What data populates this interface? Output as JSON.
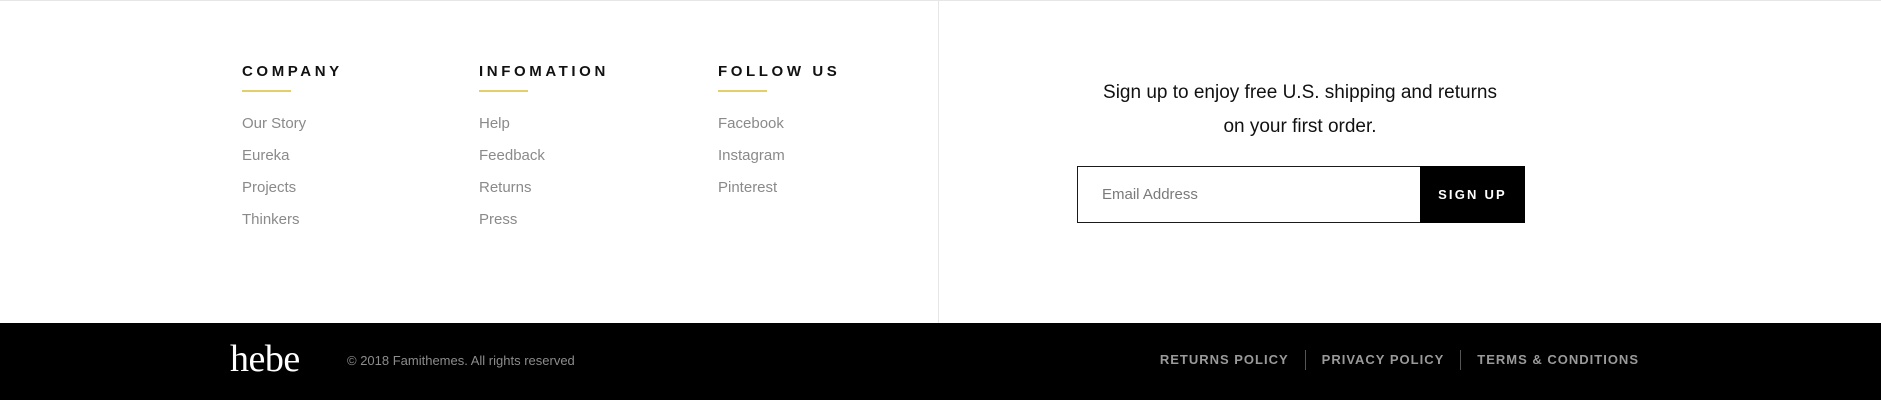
{
  "columns": {
    "company": {
      "heading": "COMPANY",
      "links": [
        "Our Story",
        "Eureka",
        "Projects",
        "Thinkers"
      ]
    },
    "information": {
      "heading": "INFOMATION",
      "links": [
        "Help",
        "Feedback",
        "Returns",
        "Press"
      ]
    },
    "follow": {
      "heading": "FOLLOW US",
      "links": [
        "Facebook",
        "Instagram",
        "Pinterest"
      ]
    }
  },
  "signup": {
    "line1": "Sign up to enjoy free U.S. shipping and returns",
    "line2": "on your first order.",
    "email_placeholder": "Email Address",
    "button_label": "SIGN UP"
  },
  "bottom": {
    "logo": "hebe",
    "copyright": "© 2018 Famithemes. All rights reserved",
    "policies": [
      "RETURNS POLICY",
      "PRIVACY POLICY",
      "TERMS & CONDITIONS"
    ]
  },
  "colors": {
    "accent_underline": "#e2cf6b",
    "bottom_bar": "#000000",
    "link_gray": "#8a8a8a"
  }
}
